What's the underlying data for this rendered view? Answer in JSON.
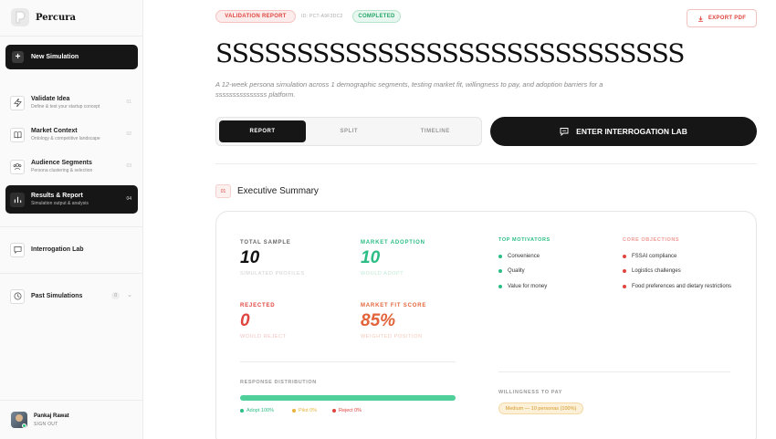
{
  "brand": {
    "name": "Percura"
  },
  "sidebar": {
    "new_simulation": "New Simulation",
    "items": [
      {
        "title": "Validate Idea",
        "subtitle": "Define & test your startup concept",
        "num": "01"
      },
      {
        "title": "Market Context",
        "subtitle": "Ontology & competitive landscape",
        "num": "02"
      },
      {
        "title": "Audience Segments",
        "subtitle": "Persona clustering & selection",
        "num": "03"
      },
      {
        "title": "Results & Report",
        "subtitle": "Simulation output & analysis",
        "num": "04"
      }
    ],
    "interrogation_lab": "Interrogation Lab",
    "past_simulations": "Past Simulations",
    "past_count": "0"
  },
  "user": {
    "name": "Pankaj Rawat",
    "action": "SIGN OUT"
  },
  "header": {
    "badge_report": "VALIDATION REPORT",
    "report_id": "ID: PCT-A9F3DC2",
    "badge_status": "COMPLETED",
    "export_label": "EXPORT PDF"
  },
  "page": {
    "title": "SSSSSSSSSSSSSSSSSSSSSSSSSSSSS",
    "description": "A 12-week persona simulation across 1 demographic segments, testing market fit, willingness to pay, and adoption barriers for a sssssssssssssss platform."
  },
  "tabs": [
    "REPORT",
    "SPLIT",
    "TIMELINE"
  ],
  "interrogation_button": "ENTER INTERROGATION LAB",
  "section": {
    "num": "01",
    "title": "Executive Summary"
  },
  "stats": {
    "total_sample": {
      "label": "TOTAL SAMPLE",
      "value": "10",
      "sub": "SIMULATED PROFILES"
    },
    "market_adoption": {
      "label": "MARKET ADOPTION",
      "value": "10",
      "sub": "WOULD ADOPT"
    },
    "rejected": {
      "label": "REJECTED",
      "value": "0",
      "sub": "WOULD REJECT"
    },
    "market_fit": {
      "label": "MARKET FIT SCORE",
      "value": "85%",
      "sub": "WEIGHTED POSITION"
    }
  },
  "motivators": {
    "title": "TOP MOTIVATORS",
    "items": [
      "Convenience",
      "Quality",
      "Value for money"
    ]
  },
  "objections": {
    "title": "CORE OBJECTIONS",
    "items": [
      "FSSAI compliance",
      "Logistics challenges",
      "Food preferences and dietary restrictions"
    ]
  },
  "distribution": {
    "title": "RESPONSE DISTRIBUTION",
    "accept_fraction": 1.0,
    "legend": {
      "accept": "Adopt 100%",
      "pilot": "Pilot 0%",
      "reject": "Reject 0%"
    }
  },
  "willingness": {
    "title": "WILLINGNESS TO PAY",
    "badge": "Medium — 10 personas (100%)"
  },
  "colors": {
    "green": "#2bbd83",
    "red": "#e0443e",
    "orange": "#e3643b",
    "amber": "#e8b33a"
  }
}
